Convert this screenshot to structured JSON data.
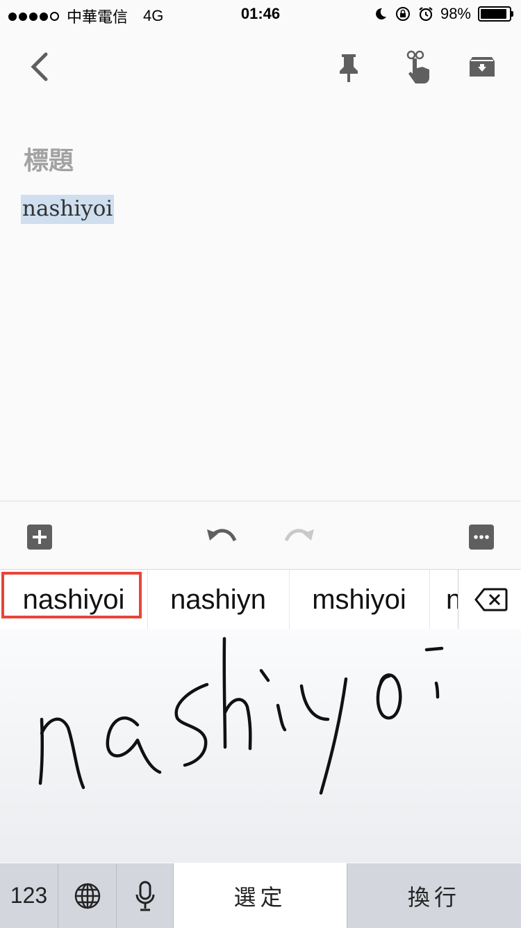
{
  "status_bar": {
    "carrier": "中華電信",
    "network": "4G",
    "time": "01:46",
    "battery_percent": 98,
    "battery_label": "98%",
    "signal_bars": 4,
    "icons": [
      "moon-icon",
      "rotation-lock-icon",
      "alarm-icon",
      "battery-icon"
    ]
  },
  "toolbar": {
    "icons": [
      "back-chevron-icon",
      "pin-icon",
      "reminder-finger-icon",
      "archive-icon"
    ]
  },
  "note": {
    "title_placeholder": "標題",
    "body": "nashiyoi"
  },
  "edit_bar": {
    "icons": [
      "add-box-icon",
      "undo-icon",
      "redo-icon",
      "more-options-icon"
    ]
  },
  "candidates": {
    "items": [
      "nashiyoi",
      "nashiyn",
      "mshiyoi",
      "n"
    ],
    "selected_index": 0,
    "highlight_color": "#e8443b"
  },
  "handwriting": {
    "ink_color": "#111111"
  },
  "keyboard": {
    "numbers_key": "123",
    "confirm_key": "選定",
    "return_key": "換行",
    "icons": [
      "globe-icon",
      "microphone-icon",
      "backspace-icon"
    ]
  }
}
